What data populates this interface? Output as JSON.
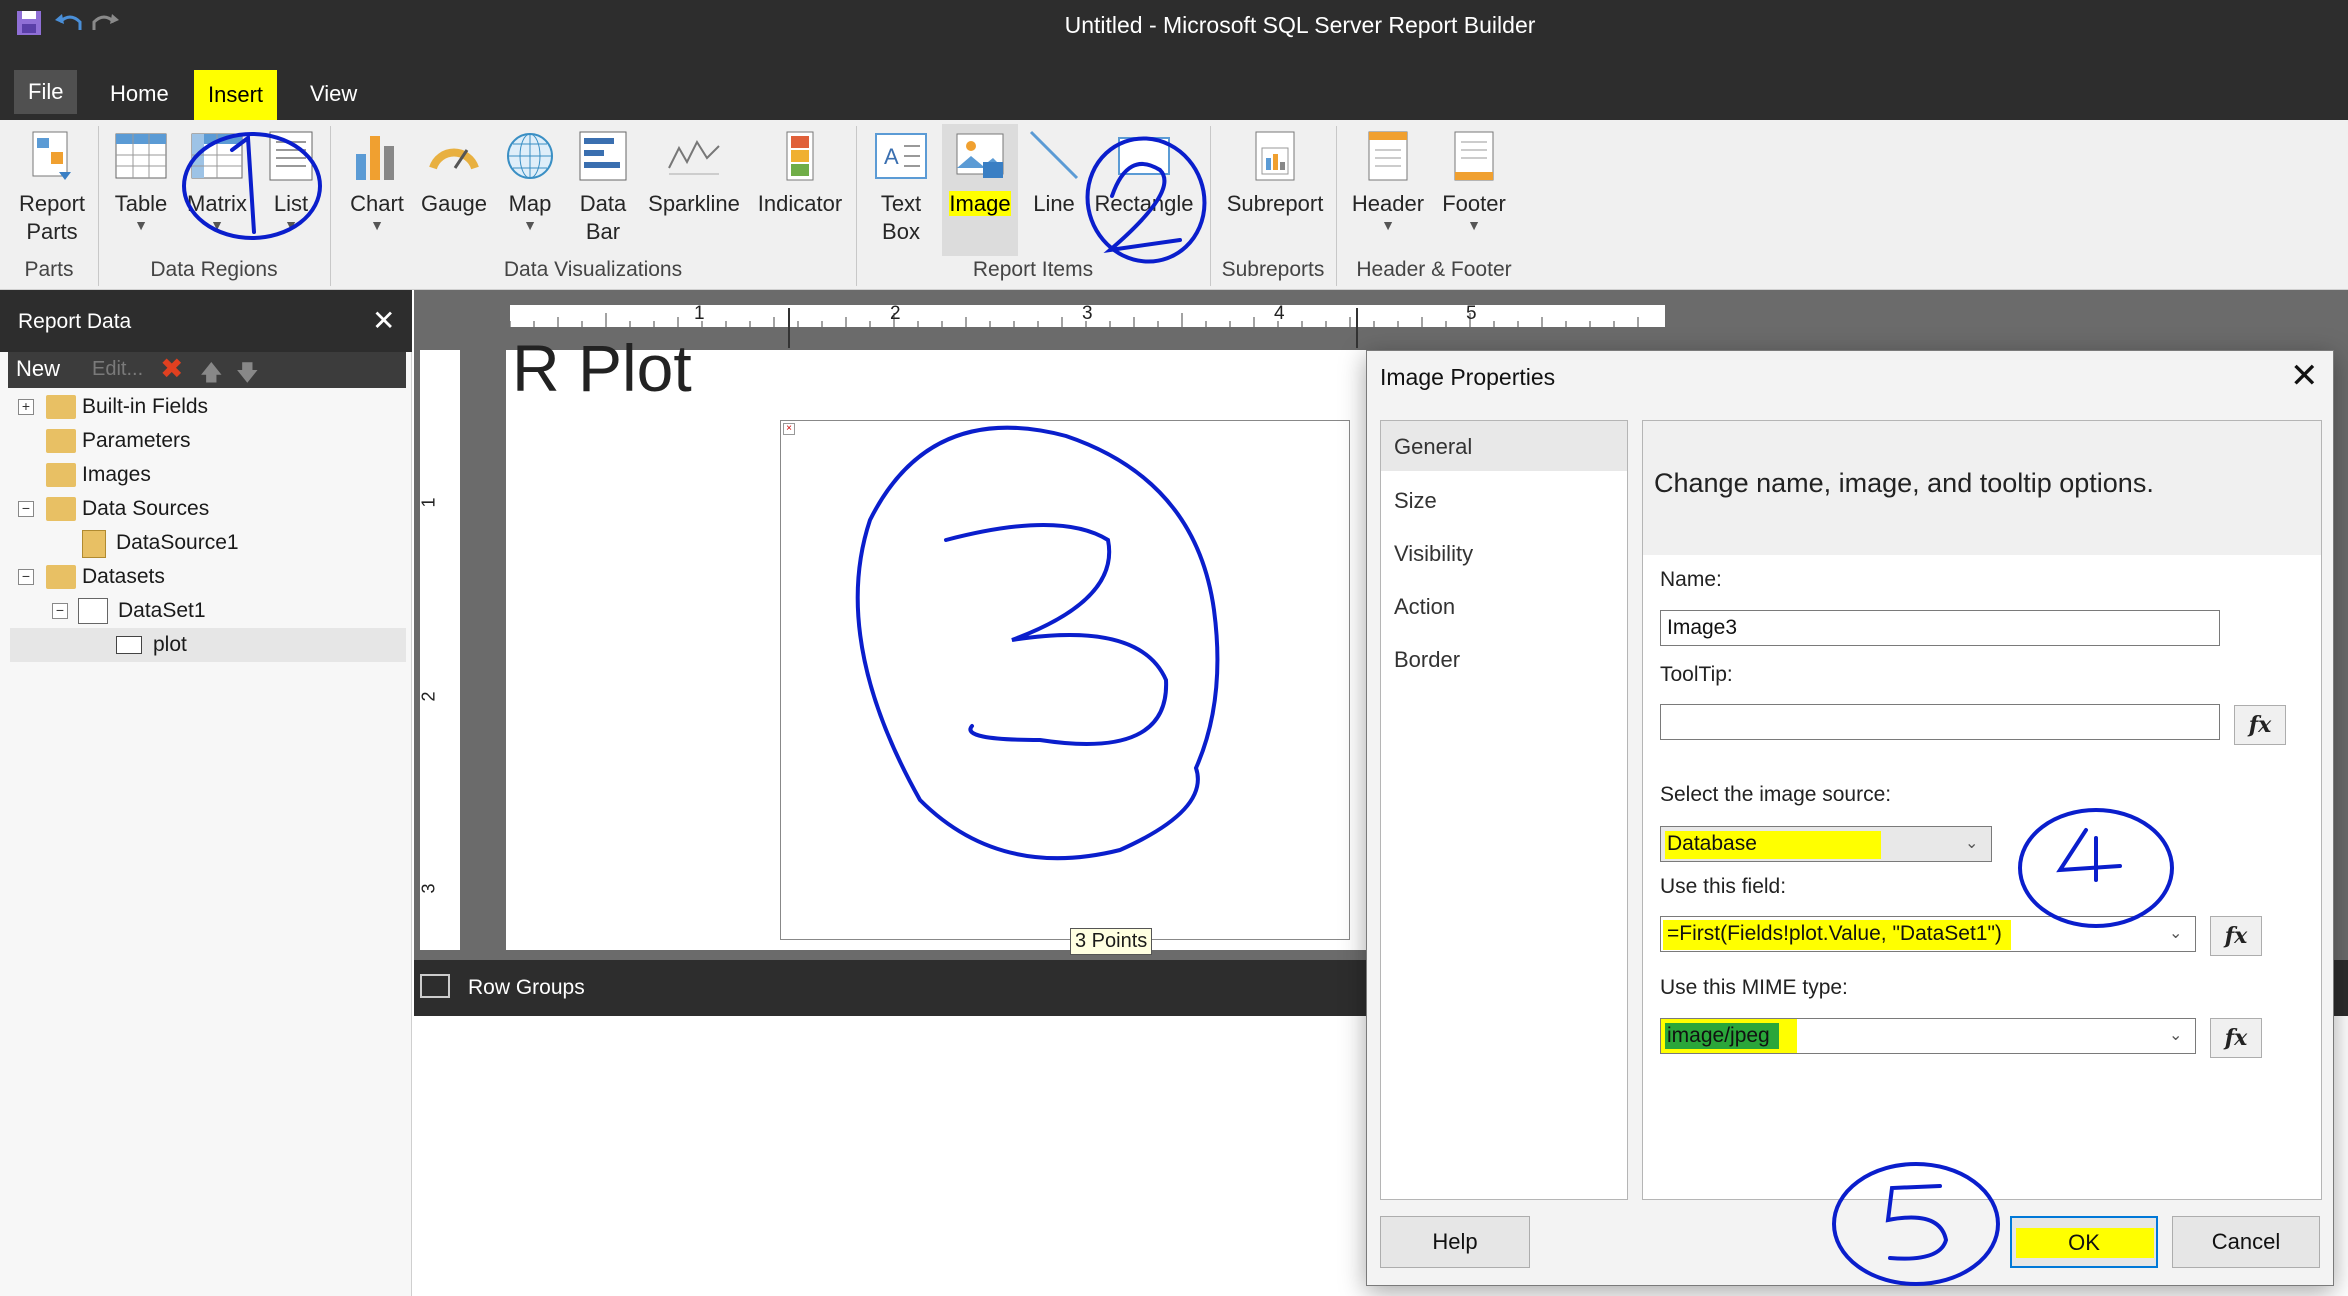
{
  "window": {
    "title": "Untitled - Microsoft SQL Server Report Builder"
  },
  "tabs": [
    {
      "label": "File"
    },
    {
      "label": "Home"
    },
    {
      "label": "Insert"
    },
    {
      "label": "View"
    }
  ],
  "ribbon": {
    "buttons": [
      {
        "line1": "Report",
        "line2": "Parts",
        "icon": "report-parts-icon"
      },
      {
        "line1": "Table",
        "line2": "",
        "icon": "table-icon"
      },
      {
        "line1": "Matrix",
        "line2": "",
        "icon": "matrix-icon"
      },
      {
        "line1": "List",
        "line2": "",
        "icon": "list-icon"
      },
      {
        "line1": "Chart",
        "line2": "",
        "icon": "chart-icon"
      },
      {
        "line1": "Gauge",
        "line2": "",
        "icon": "gauge-icon"
      },
      {
        "line1": "Map",
        "line2": "",
        "icon": "map-icon"
      },
      {
        "line1": "Data",
        "line2": "Bar",
        "icon": "data-bar-icon"
      },
      {
        "line1": "Sparkline",
        "line2": "",
        "icon": "sparkline-icon"
      },
      {
        "line1": "Indicator",
        "line2": "",
        "icon": "indicator-icon"
      },
      {
        "line1": "Text",
        "line2": "Box",
        "icon": "text-box-icon"
      },
      {
        "line1": "Image",
        "line2": "",
        "icon": "image-icon"
      },
      {
        "line1": "Line",
        "line2": "",
        "icon": "line-icon"
      },
      {
        "line1": "Rectangle",
        "line2": "",
        "icon": "rectangle-icon"
      },
      {
        "line1": "Subreport",
        "line2": "",
        "icon": "subreport-icon"
      },
      {
        "line1": "Header",
        "line2": "",
        "icon": "header-icon"
      },
      {
        "line1": "Footer",
        "line2": "",
        "icon": "footer-icon"
      }
    ],
    "groups": [
      "Parts",
      "Data Regions",
      "Data Visualizations",
      "Report Items",
      "Subreports",
      "Header & Footer"
    ]
  },
  "report_data": {
    "title": "Report Data",
    "new_label": "New",
    "edit_label": "Edit...",
    "tree": [
      {
        "label": "Built-in Fields"
      },
      {
        "label": "Parameters"
      },
      {
        "label": "Images"
      },
      {
        "label": "Data Sources"
      },
      {
        "label": "DataSource1"
      },
      {
        "label": "Datasets"
      },
      {
        "label": "DataSet1"
      },
      {
        "label": "plot"
      }
    ]
  },
  "canvas": {
    "ruler_marks": [
      "1",
      "2",
      "3",
      "4",
      "5"
    ],
    "left_ruler_marks": [
      "1",
      "2",
      "3"
    ],
    "report_title": "R Plot",
    "tooltip": "3 Points"
  },
  "row_groups": {
    "label": "Row Groups"
  },
  "dialog": {
    "title": "Image Properties",
    "nav": [
      "General",
      "Size",
      "Visibility",
      "Action",
      "Border"
    ],
    "heading": "Change name, image, and tooltip options.",
    "name_label": "Name:",
    "name_value": "Image3",
    "tooltip_label": "ToolTip:",
    "tooltip_value": "",
    "source_label": "Select the image source:",
    "source_value": "Database",
    "field_label": "Use this field:",
    "field_value": "=First(Fields!plot.Value, \"DataSet1\")",
    "mime_label": "Use this MIME type:",
    "mime_value": "image/jpeg",
    "fx_label": "fx",
    "help_label": "Help",
    "ok_label": "OK",
    "cancel_label": "Cancel"
  },
  "annotations": [
    "1",
    "2",
    "3",
    "4",
    "5"
  ],
  "colors": {
    "highlight": "#ffff00",
    "annotation": "#0a1ecc",
    "dark_chrome": "#2d2d2d"
  }
}
